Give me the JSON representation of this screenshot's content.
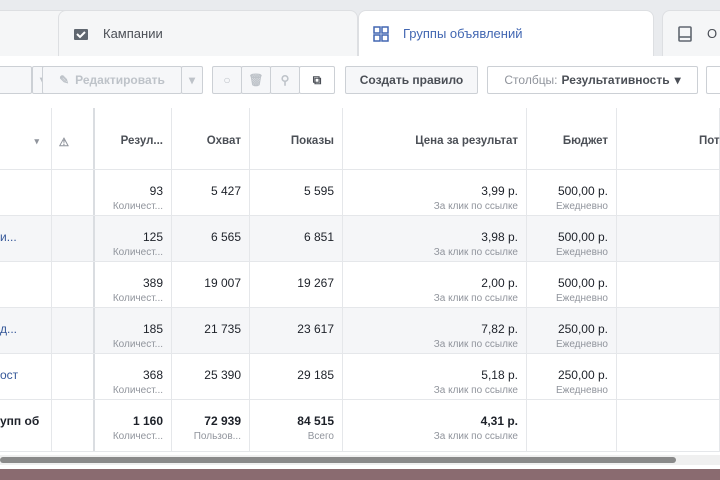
{
  "tabs": [
    {
      "label": "Кампании",
      "icon": "folder-check-icon"
    },
    {
      "label": "Группы объявлений",
      "icon": "grid-icon",
      "active": true
    },
    {
      "label": "О",
      "icon": "ad-icon"
    }
  ],
  "toolbar": {
    "edit": "Редактировать",
    "create_rule": "Создать правило",
    "columns_label": "Столбцы:",
    "columns_value": "Результативность"
  },
  "columns": [
    "Резул...",
    "Охват",
    "Показы",
    "Цена за результат",
    "Бюджет",
    "Пот"
  ],
  "rows": [
    {
      "name": "",
      "result": "93",
      "result_sub": "Количест...",
      "reach": "5 427",
      "impr": "5 595",
      "price": "3,99 р.",
      "price_sub": "За клик по ссылке",
      "budget": "500,00 р.",
      "budget_sub": "Ежедневно"
    },
    {
      "name": "и...",
      "result": "125",
      "result_sub": "Количест...",
      "reach": "6 565",
      "impr": "6 851",
      "price": "3,98 р.",
      "price_sub": "За клик по ссылке",
      "budget": "500,00 р.",
      "budget_sub": "Ежедневно"
    },
    {
      "name": "",
      "result": "389",
      "result_sub": "Количест...",
      "reach": "19 007",
      "impr": "19 267",
      "price": "2,00 р.",
      "price_sub": "За клик по ссылке",
      "budget": "500,00 р.",
      "budget_sub": "Ежедневно"
    },
    {
      "name": "д...",
      "result": "185",
      "result_sub": "Количест...",
      "reach": "21 735",
      "impr": "23 617",
      "price": "7,82 р.",
      "price_sub": "За клик по ссылке",
      "budget": "250,00 р.",
      "budget_sub": "Ежедневно"
    },
    {
      "name": "ост",
      "result": "368",
      "result_sub": "Количест...",
      "reach": "25 390",
      "impr": "29 185",
      "price": "5,18 р.",
      "price_sub": "За клик по ссылке",
      "budget": "250,00 р.",
      "budget_sub": "Ежедневно"
    }
  ],
  "total": {
    "name": "упп об",
    "result": "1 160",
    "result_sub": "Количест...",
    "reach": "72 939",
    "reach_sub": "Пользов...",
    "impr": "84 515",
    "impr_sub": "Всего",
    "price": "4,31 р.",
    "price_sub": "За клик по ссылке"
  }
}
